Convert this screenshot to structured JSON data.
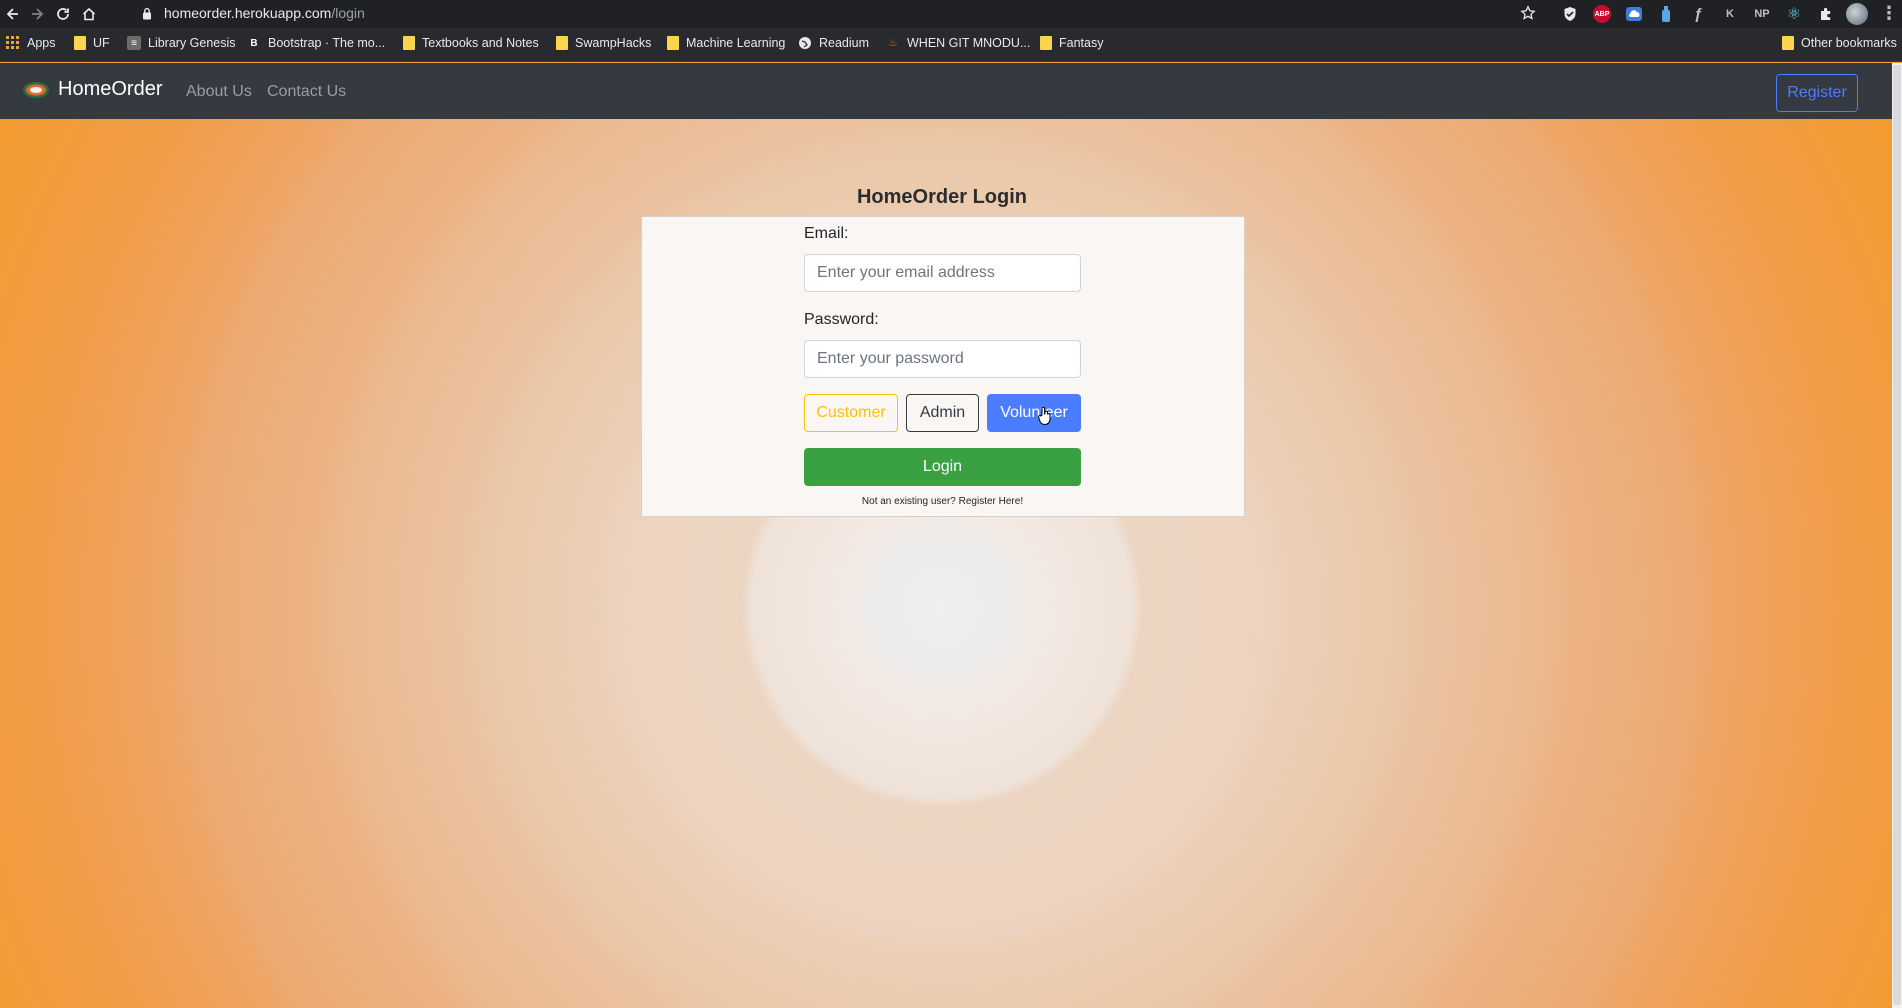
{
  "browser": {
    "url_host": "homeorder.herokuapp.com",
    "url_path": "/login",
    "icons": [
      "back-icon",
      "forward-icon",
      "reload-icon",
      "home-icon",
      "lock-icon",
      "star-icon"
    ],
    "extensions": [
      "shield-icon",
      "adblock-icon",
      "cloud-icon",
      "bottle-icon",
      "f-icon",
      "k-icon",
      "np-icon",
      "react-icon",
      "puzzle-icon",
      "profile-avatar"
    ],
    "ext_labels": {
      "abp": "ABP",
      "f": "ƒ",
      "k": "K",
      "np": "NP"
    }
  },
  "bookmarks": {
    "apps": "Apps",
    "items": [
      "UF",
      "Library Genesis",
      "Bootstrap · The mo...",
      "Textbooks and Notes",
      "SwampHacks",
      "Machine Learning",
      "Readium",
      "WHEN GIT MNODU...",
      "Fantasy"
    ],
    "other": "Other bookmarks"
  },
  "navbar": {
    "brand": "HomeOrder",
    "links": [
      "About Us",
      "Contact Us"
    ],
    "register": "Register"
  },
  "login": {
    "title": "HomeOrder Login",
    "email_label": "Email:",
    "email_placeholder": "Enter your email address",
    "password_label": "Password:",
    "password_placeholder": "Enter your password",
    "roles": [
      "Customer",
      "Admin",
      "Volunteer"
    ],
    "selected_role": "Volunteer",
    "login_button": "Login",
    "register_prompt": "Not an existing user? Register Here!"
  },
  "colors": {
    "navbar_bg": "#343a40",
    "background": "#f39a2a",
    "customer": "#ffc107",
    "volunteer": "#4a7dff",
    "login": "#3aa142"
  }
}
